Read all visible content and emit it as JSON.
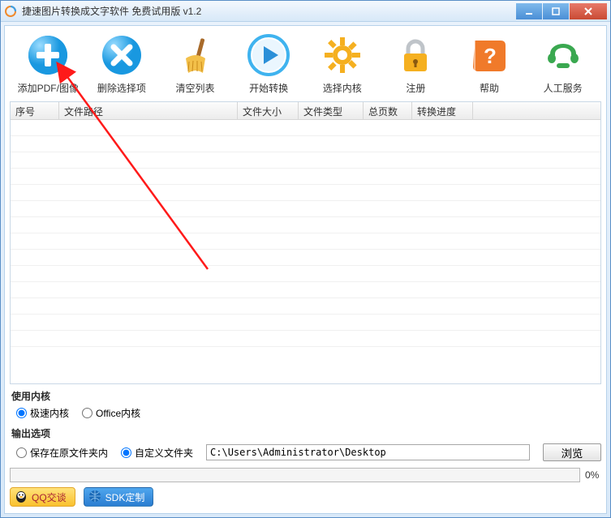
{
  "window": {
    "title": "捷速图片转换成文字软件 免费试用版 v1.2"
  },
  "toolbar": {
    "add": "添加PDF/图像",
    "remove": "删除选择项",
    "clear": "清空列表",
    "start": "开始转换",
    "kernel": "选择内核",
    "register": "注册",
    "help": "帮助",
    "service": "人工服务"
  },
  "table": {
    "cols": {
      "seq": "序号",
      "path": "文件路径",
      "size": "文件大小",
      "type": "文件类型",
      "pages": "总页数",
      "progress": "转换进度"
    }
  },
  "kernel_section": {
    "label": "使用内核",
    "fast": "极速内核",
    "office": "Office内核",
    "selected": "fast"
  },
  "output_section": {
    "label": "输出选项",
    "same_folder": "保存在原文件夹内",
    "custom_folder": "自定义文件夹",
    "selected": "custom",
    "path": "C:\\Users\\Administrator\\Desktop",
    "browse": "浏览"
  },
  "progress": {
    "percent_text": "0%"
  },
  "footer": {
    "qq": "QQ交谈",
    "sdk": "SDK定制"
  }
}
